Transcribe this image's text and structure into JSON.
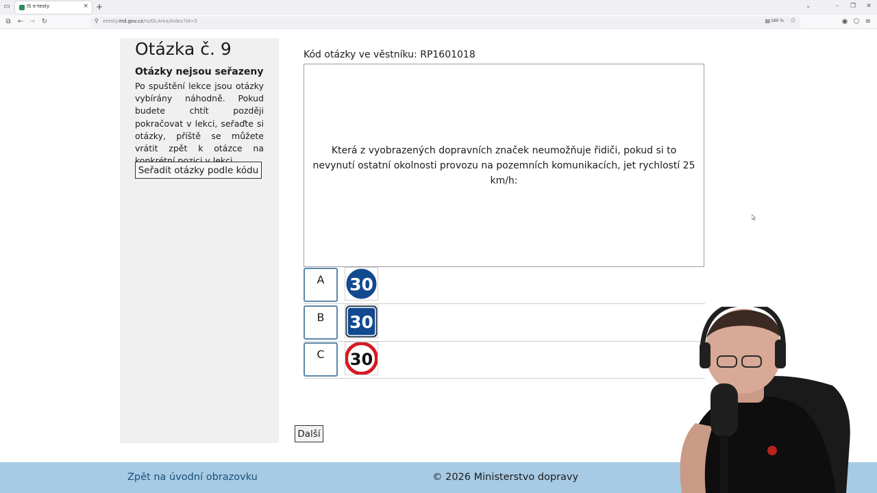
{
  "browser": {
    "tab_title": "IS e-testy",
    "tab_close": "×",
    "new_tab": "+",
    "url_prefix": "etesty.",
    "url_domain": "md.gov.cz",
    "url_path": "/ro/DLArea/Index?id=5",
    "zoom": "180 %"
  },
  "sidebar": {
    "question_title": "Otázka č. 9",
    "heading": "Otázky nejsou seřazeny",
    "description": "Po spuštění lekce jsou otázky vybírány náhodně. Pokud budete chtít později pokračovat v lekci, seřaďte si otázky, příště se můžete vrátit zpět k otázce na konkrétní pozici v lekci.",
    "sort_button": "Seřadit otázky podle kódu"
  },
  "question": {
    "code_label": "Kód otázky ve věstníku: RP1601018",
    "text": "Která z vyobrazených dopravních značek neumožňuje řidiči, pokud si to nevynutí ostatní okolnosti provozu na pozemních komunikacích, jet rychlostí 25 km/h:"
  },
  "answers": [
    {
      "letter": "A",
      "sign_type": "blue-circle-minimum-speed",
      "sign_text": "30"
    },
    {
      "letter": "B",
      "sign_type": "blue-square-speed",
      "sign_text": "30"
    },
    {
      "letter": "C",
      "sign_type": "red-circle-speed-limit",
      "sign_text": "30"
    }
  ],
  "next_button": "Další",
  "footer": {
    "back_link": "Zpět na úvodní obrazovku",
    "copyright": "© 2026 Ministerstvo dopravy"
  },
  "colors": {
    "footer_bg": "#a7cbe4",
    "sidebar_bg": "#f0f0f0",
    "answer_border": "#5b87a8",
    "sign_blue": "#12498f",
    "sign_red": "#d41a24"
  }
}
